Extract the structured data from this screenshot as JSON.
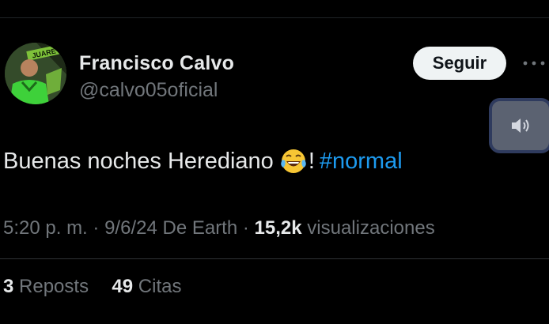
{
  "tweet": {
    "display_name": "Francisco Calvo",
    "handle": "@calvo05oficial",
    "follow_label": "Seguir",
    "text_main": "Buenas noches Herediano",
    "emoji": "face-with-tears-of-joy",
    "text_exclaim": "!",
    "hashtag": "#normal",
    "time": "5:20 p. m.",
    "date": "9/6/24",
    "source": "De Earth",
    "views_count": "15,2k",
    "views_label": "visualizaciones",
    "reposts_count": "3",
    "reposts_label": "Reposts",
    "quotes_count": "49",
    "quotes_label": "Citas",
    "avatar_logo_text": "JUARE"
  },
  "colors": {
    "background": "#000000",
    "text": "#e7e9ea",
    "muted": "#71767b",
    "link": "#1d9bf0",
    "follow_bg": "#eff3f4"
  }
}
